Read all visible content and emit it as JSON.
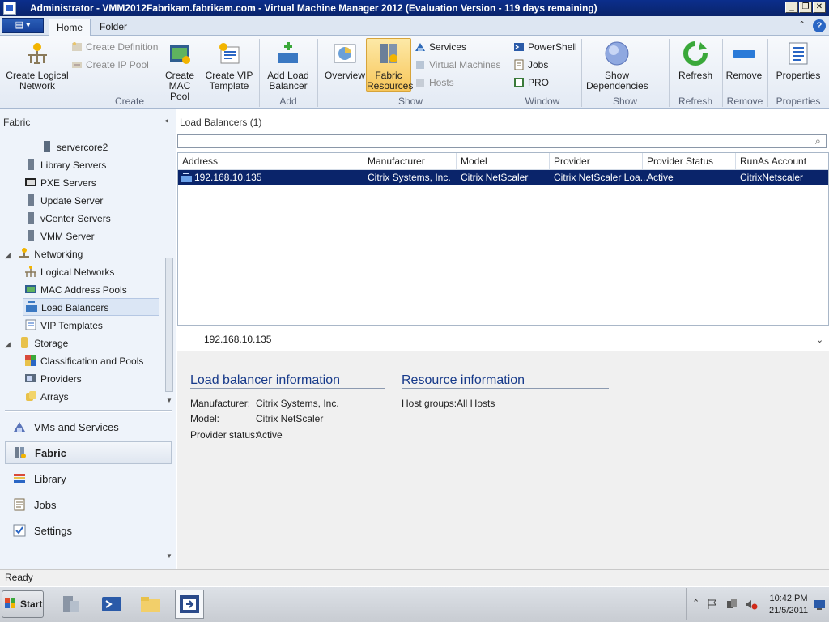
{
  "window": {
    "title": "Administrator - VMM2012Fabrikam.fabrikam.com - Virtual Machine Manager 2012 (Evaluation Version - 119 days remaining)"
  },
  "window_controls": {
    "minimize": "_",
    "restore": "❐",
    "close": "✕"
  },
  "ribbon": {
    "tabs": [
      "Home",
      "Folder"
    ],
    "help": "?",
    "minimize_ribbon": "⌃",
    "create_logical_network": "Create Logical Network",
    "create_definition": "Create Definition",
    "create_ip_pool": "Create IP Pool",
    "create_mac_pool": "Create MAC Pool",
    "create_vip_template": "Create VIP Template",
    "add_load_balancer": "Add Load Balancer",
    "overview": "Overview",
    "fabric_resources": "Fabric Resources",
    "services": "Services",
    "virtual_machines": "Virtual Machines",
    "hosts": "Hosts",
    "powershell": "PowerShell",
    "jobs": "Jobs",
    "pro": "PRO",
    "show_dependencies": "Show Dependencies",
    "refresh": "Refresh",
    "remove": "Remove",
    "properties": "Properties",
    "groups": {
      "create": "Create",
      "add": "Add",
      "show": "Show",
      "window": "Window",
      "show_dependencies": "Show Dependencies",
      "refresh": "Refresh",
      "remove": "Remove",
      "properties": "Properties"
    }
  },
  "left": {
    "header": "Fabric",
    "collapse": "◂",
    "tree": {
      "servercore2": "servercore2",
      "library_servers": "Library Servers",
      "pxe_servers": "PXE Servers",
      "update_server": "Update Server",
      "vcenter_servers": "vCenter Servers",
      "vmm_server": "VMM Server",
      "networking": "Networking",
      "logical_networks": "Logical Networks",
      "mac_address_pools": "MAC Address Pools",
      "load_balancers": "Load Balancers",
      "vip_templates": "VIP Templates",
      "storage": "Storage",
      "classification_and_pools": "Classification and Pools",
      "providers": "Providers",
      "arrays": "Arrays"
    },
    "nav": {
      "vms_and_services": "VMs and Services",
      "fabric": "Fabric",
      "library": "Library",
      "jobs": "Jobs",
      "settings": "Settings"
    }
  },
  "main": {
    "header": "Load Balancers (1)",
    "search_placeholder": "",
    "columns": {
      "address": "Address",
      "manufacturer": "Manufacturer",
      "model": "Model",
      "provider": "Provider",
      "provider_status": "Provider Status",
      "runas_account": "RunAs Account"
    },
    "row": {
      "address": "192.168.10.135",
      "manufacturer": "Citrix Systems, Inc.",
      "model": "Citrix NetScaler",
      "provider": "Citrix NetScaler Loa...",
      "provider_status": "Active",
      "runas_account": "CitrixNetscaler"
    },
    "detail_title": "192.168.10.135",
    "lb_info": {
      "heading": "Load balancer information",
      "manufacturer_label": "Manufacturer:",
      "manufacturer_value": "Citrix Systems, Inc.",
      "model_label": "Model:",
      "model_value": "Citrix NetScaler",
      "status_label": "Provider status:",
      "status_value": "Active"
    },
    "resource_info": {
      "heading": "Resource information",
      "host_groups_label": "Host groups:",
      "host_groups_value": "All Hosts"
    }
  },
  "status": {
    "text": "Ready"
  },
  "taskbar": {
    "start": "Start",
    "time": "10:42 PM",
    "date": "21/5/2011"
  },
  "colors": {
    "selection": "#0a246a",
    "accent": "#173a8a"
  }
}
